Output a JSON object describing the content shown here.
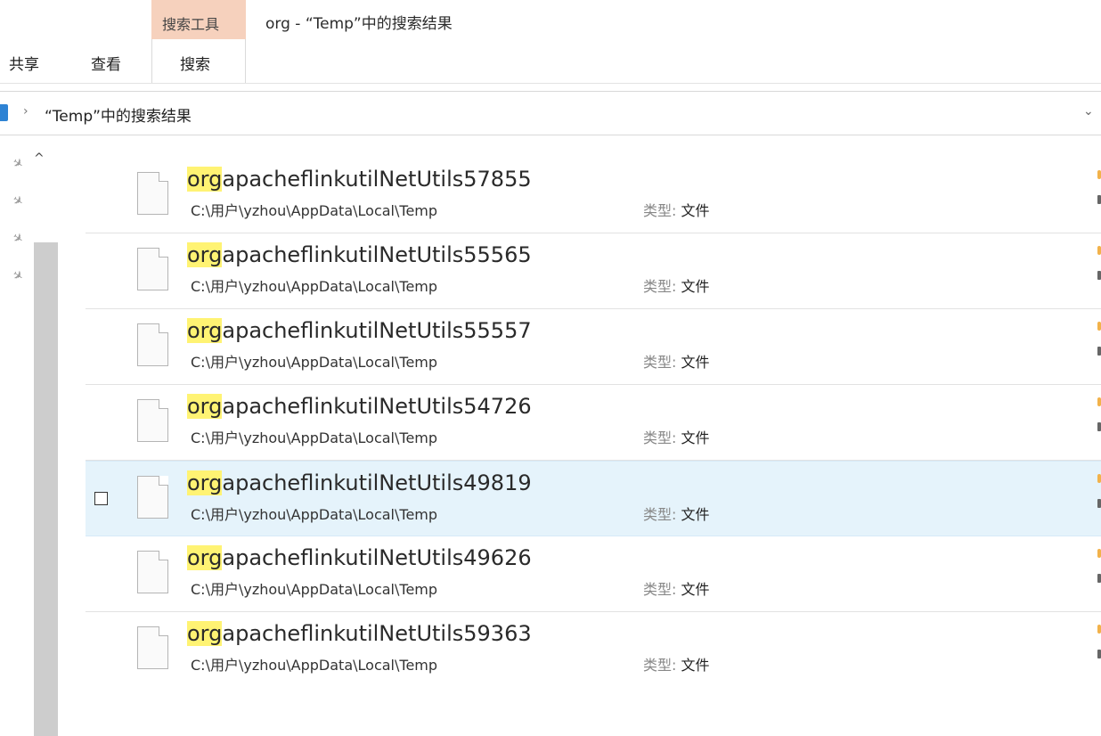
{
  "title_bar": {
    "contextual_tab": "搜索工具",
    "window_title": "org - “Temp”中的搜索结果"
  },
  "ribbon": {
    "tabs": [
      {
        "label": "共享"
      },
      {
        "label": "查看"
      },
      {
        "label": "搜索"
      }
    ]
  },
  "address_bar": {
    "separator": "›",
    "location": "“Temp”中的搜索结果",
    "dropdown": "⌄"
  },
  "nav_pane": {
    "pin_glyph": "✈",
    "up_glyph": "^"
  },
  "results": [
    {
      "highlight": "org",
      "rest": "apacheflinkutilNetUtils57855",
      "path": "C:\\用户\\yzhou\\AppData\\Local\\Temp",
      "type_key": "类型:",
      "type_value": "文件"
    },
    {
      "highlight": "org",
      "rest": "apacheflinkutilNetUtils55565",
      "path": "C:\\用户\\yzhou\\AppData\\Local\\Temp",
      "type_key": "类型:",
      "type_value": "文件"
    },
    {
      "highlight": "org",
      "rest": "apacheflinkutilNetUtils55557",
      "path": "C:\\用户\\yzhou\\AppData\\Local\\Temp",
      "type_key": "类型:",
      "type_value": "文件"
    },
    {
      "highlight": "org",
      "rest": "apacheflinkutilNetUtils54726",
      "path": "C:\\用户\\yzhou\\AppData\\Local\\Temp",
      "type_key": "类型:",
      "type_value": "文件"
    },
    {
      "highlight": "org",
      "rest": "apacheflinkutilNetUtils49819",
      "path": "C:\\用户\\yzhou\\AppData\\Local\\Temp",
      "type_key": "类型:",
      "type_value": "文件"
    },
    {
      "highlight": "org",
      "rest": "apacheflinkutilNetUtils49626",
      "path": "C:\\用户\\yzhou\\AppData\\Local\\Temp",
      "type_key": "类型:",
      "type_value": "文件"
    },
    {
      "highlight": "org",
      "rest": "apacheflinkutilNetUtils59363",
      "path": "C:\\用户\\yzhou\\AppData\\Local\\Temp",
      "type_key": "类型:",
      "type_value": "文件"
    }
  ],
  "colors": {
    "contextual_tab_bg": "#f6d1bd",
    "match_highlight": "#fff373",
    "hover_row_bg": "#e5f3fb"
  }
}
